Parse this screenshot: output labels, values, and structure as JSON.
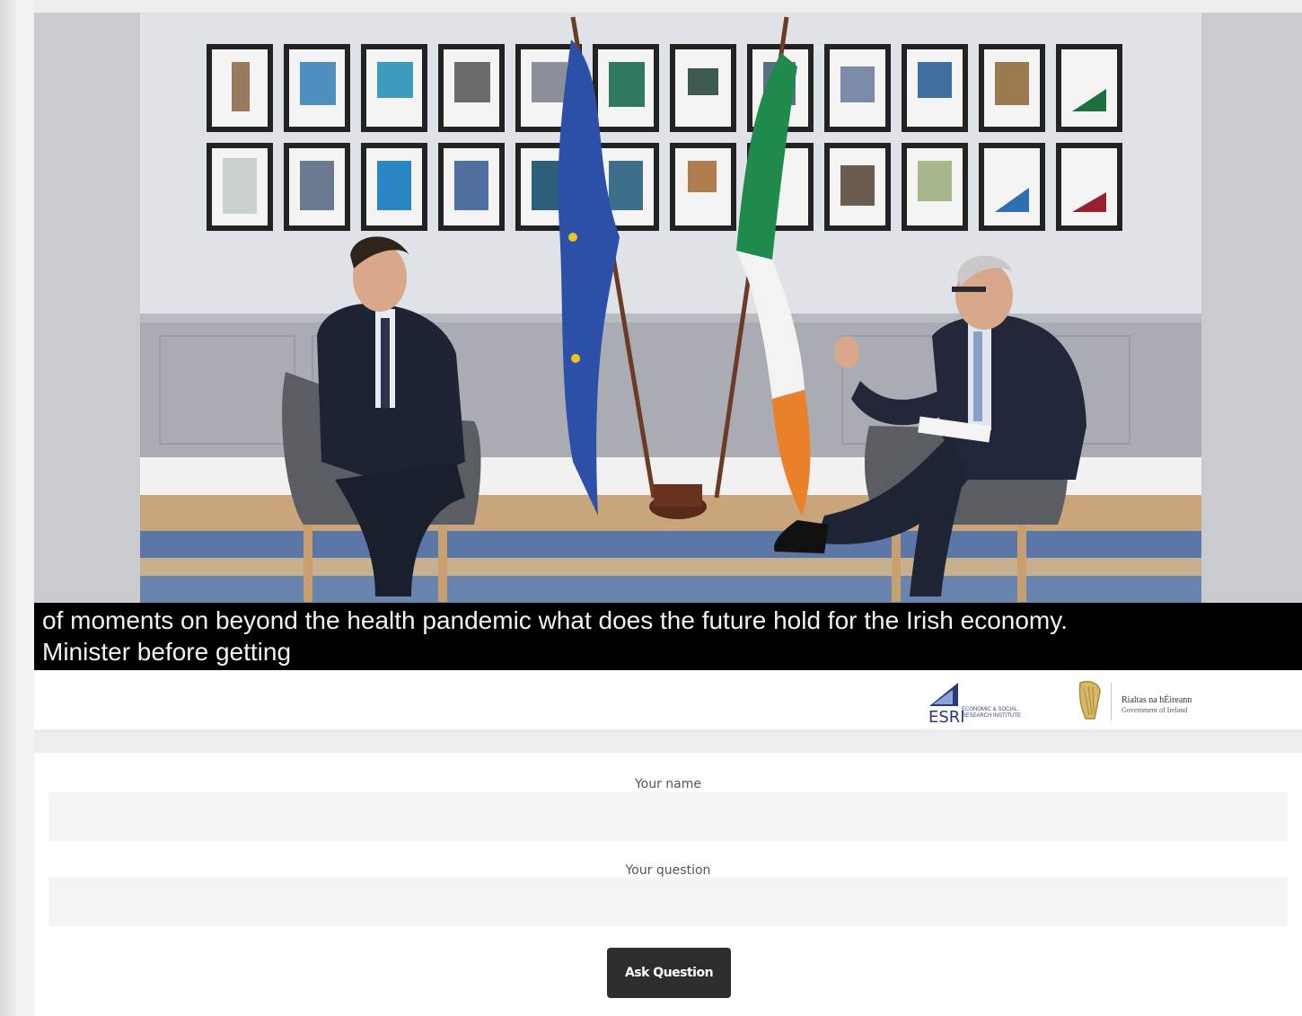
{
  "video": {
    "captions": [
      "of moments on beyond the health pandemic what does the future hold for the Irish economy.",
      "Minister before getting"
    ]
  },
  "logos": {
    "esri": {
      "mark": "ESRI",
      "text": "ECONOMIC & SOCIAL RESEARCH INSTITUTE"
    },
    "government": {
      "line1": "Rialtas na hÉireann",
      "line2": "Government of Ireland",
      "icon": "harp-icon"
    }
  },
  "form": {
    "name_label": "Your name",
    "name_value": "",
    "question_label": "Your question",
    "question_value": "",
    "submit_label": "Ask Question"
  },
  "colors": {
    "caption_bg": "#000000",
    "button_bg": "#2d2d2d",
    "eu_flag": "#2c4fa8",
    "ireland_green": "#1f8a4c",
    "ireland_orange": "#e8812a"
  }
}
